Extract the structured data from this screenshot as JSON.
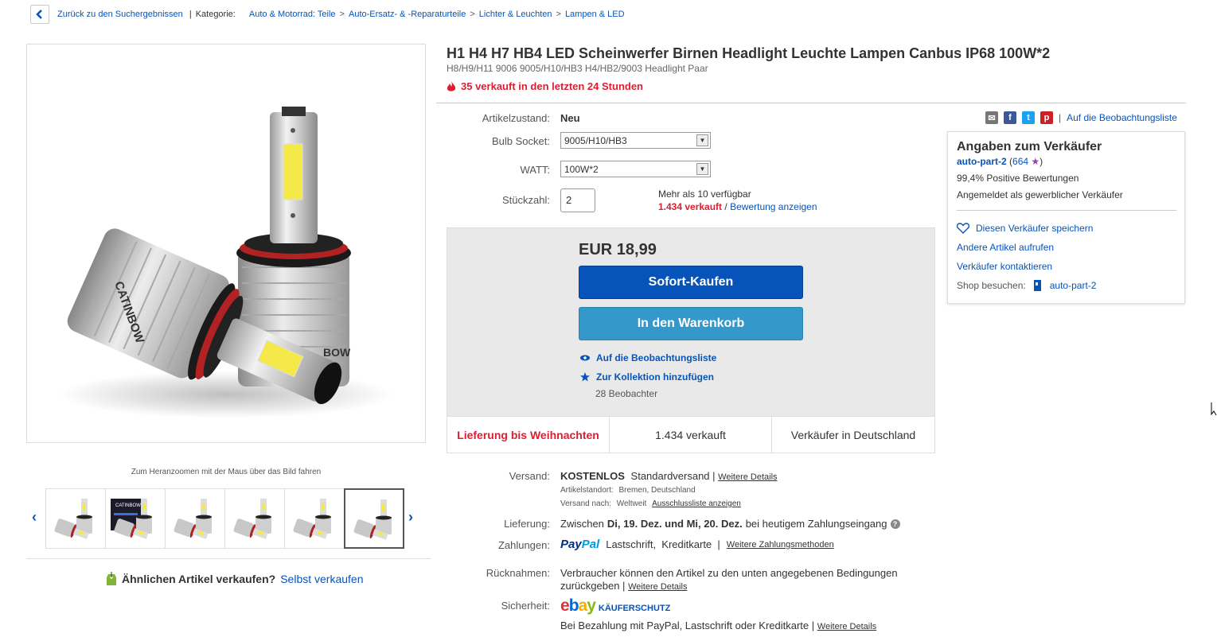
{
  "breadcrumb": {
    "back_label": "Zurück zu den Suchergebnissen",
    "category_label": "Kategorie:",
    "items": [
      "Auto & Motorrad: Teile",
      "Auto-Ersatz- & -Reparaturteile",
      "Lichter & Leuchten",
      "Lampen & LED"
    ],
    "sep": ">",
    "pipe": "|"
  },
  "gallery": {
    "zoom_hint": "Zum Heranzoomen mit der Maus über das Bild fahren",
    "brand_text": "CATINBOW",
    "brand_text_partial": "BOW",
    "thumbnail_count": 6,
    "selected_thumbnail": 6,
    "box_text": "CATINBOW"
  },
  "similar": {
    "question": "Ähnlichen Artikel verkaufen?",
    "link": "Selbst verkaufen"
  },
  "item": {
    "title": "H1 H4 H7 HB4 LED Scheinwerfer Birnen Headlight Leuchte Lampen Canbus IP68 100W*2",
    "subtitle": "H8/H9/H11 9006 9005/H10/HB3 H4/HB2/9003 Headlight Paar",
    "hot_text": "35 verkauft in den letzten 24 Stunden"
  },
  "specs": {
    "condition_label": "Artikelzustand:",
    "condition_value": "Neu",
    "socket_label": "Bulb Socket:",
    "socket_value": "9005/H10/HB3",
    "watt_label": "WATT:",
    "watt_value": "100W*2",
    "qty_label": "Stückzahl:",
    "qty_value": "2",
    "available": "Mehr als 10 verfügbar",
    "sold_count": "1.434 verkauft",
    "slash": "/",
    "reviews_link": "Bewertung anzeigen"
  },
  "buy": {
    "price": "EUR 18,99",
    "buy_now": "Sofort-Kaufen",
    "add_cart": "In den Warenkorb",
    "watch": "Auf die Beobachtungsliste",
    "collection": "Zur Kollektion hinzufügen",
    "watchers": "28 Beobachter",
    "strip": [
      "Lieferung bis Weihnachten",
      "1.434 verkauft",
      "Verkäufer in Deutschland"
    ]
  },
  "share": {
    "pipe": "|",
    "watchlist_link": "Auf die Beobachtungsliste"
  },
  "seller": {
    "title": "Angaben zum Verkäufer",
    "name": "auto-part-2",
    "score_open": "(",
    "score": "664",
    "score_close": ")",
    "positive": "99,4% Positive Bewertungen",
    "registered": "Angemeldet als gewerblicher Verkäufer",
    "save": "Diesen Verkäufer speichern",
    "other_items": "Andere Artikel aufrufen",
    "contact": "Verkäufer kontaktieren",
    "shop_label": "Shop besuchen:",
    "shop_name": "auto-part-2"
  },
  "shipping": {
    "label": "Versand:",
    "free": "KOSTENLOS",
    "standard": "Standardversand |",
    "details": "Weitere Details",
    "location_label": "Artikelstandort:",
    "location": "Bremen, Deutschland",
    "ships_to_label": "Versand nach:",
    "ships_to": "Weltweit",
    "exclusions": "Ausschlussliste anzeigen"
  },
  "delivery": {
    "label": "Lieferung:",
    "prefix": "Zwischen",
    "range": "Di, 19. Dez. und Mi, 20. Dez.",
    "suffix": "bei heutigem Zahlungseingang"
  },
  "payment": {
    "label": "Zahlungen:",
    "paypal_a": "Pay",
    "paypal_b": "Pal",
    "methods": "Lastschrift,  Kreditkarte  |",
    "more": "Weitere Zahlungsmethoden"
  },
  "returns": {
    "label": "Rücknahmen:",
    "text_line1": "Verbraucher können den Artikel zu den unten angegebenen Bedingungen",
    "text_line2": "zurückgeben |",
    "details": "Weitere Details"
  },
  "security": {
    "label": "Sicherheit:",
    "logo": "ebay",
    "protection": "KÄUFERSCHUTZ",
    "text": "Bei Bezahlung mit PayPal, Lastschrift oder Kreditkarte |",
    "details": "Weitere Details"
  },
  "colors": {
    "link": "#0654ba",
    "red": "#dd1e31",
    "buy_button": "#0654ba",
    "cart_button": "#3498ca"
  }
}
